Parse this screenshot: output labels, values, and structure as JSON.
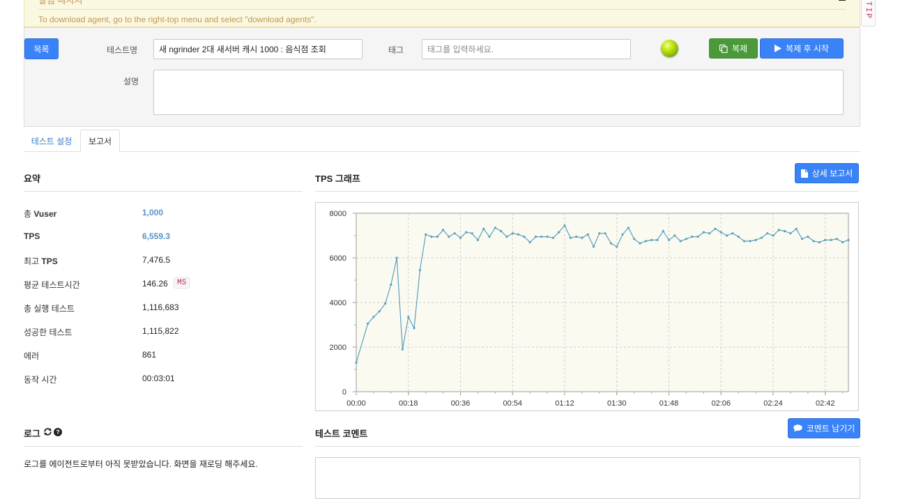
{
  "notice": {
    "title": "알림 메시지",
    "text": "To download agent, go to the right-top menu and select \"download agents\"."
  },
  "tip_tab": {
    "label": "TIP"
  },
  "form": {
    "list_button": "목록",
    "test_name_label": "테스트명",
    "test_name_value": "새 ngrinder 2대 새서버 캐시 1000 : 음식점 조회",
    "tag_label": "태그",
    "tag_placeholder": "태그를 입력하세요.",
    "description_label": "설명",
    "description_value": "",
    "copy_button": "복제",
    "copy_start_button": "복제 후 시작",
    "status_color": "#a6cc0e"
  },
  "tabs": [
    {
      "label": "테스트 설정",
      "active": false
    },
    {
      "label": "보고서",
      "active": true
    }
  ],
  "summary": {
    "title": "요약",
    "rows": [
      {
        "label_prefix": "총 ",
        "label_bold": "Vuser",
        "value": "1,000"
      },
      {
        "label_prefix": "",
        "label_bold": "TPS",
        "value": "6,559.3"
      },
      {
        "label_prefix": "최고 ",
        "label_bold": "TPS",
        "value": "7,476.5"
      },
      {
        "label_prefix": "평균 테스트시간",
        "label_bold": "",
        "value": "146.26",
        "unit": "MS"
      },
      {
        "label_prefix": "총 실행 테스트",
        "label_bold": "",
        "value": "1,116,683"
      },
      {
        "label_prefix": "성공한 테스트",
        "label_bold": "",
        "value": "1,115,822"
      },
      {
        "label_prefix": "에러",
        "label_bold": "",
        "value": "861"
      },
      {
        "label_prefix": "동작 시간",
        "label_bold": "",
        "value": "00:03:01"
      }
    ]
  },
  "tps_panel": {
    "title": "TPS 그래프",
    "detail_button": "상세 보고서"
  },
  "log": {
    "title": "로그",
    "message": "로그를 에이전트로부터 아직 못받았습니다. 화면을 재로딩 해주세요."
  },
  "comment": {
    "title": "테스트 코멘트",
    "button": "코멘트 남기기",
    "value": ""
  },
  "chart_data": {
    "type": "line",
    "title": "",
    "xlabel": "",
    "ylabel": "",
    "x_ticks": [
      "00:00",
      "00:18",
      "00:36",
      "00:54",
      "01:12",
      "01:30",
      "01:48",
      "02:06",
      "02:24",
      "02:42"
    ],
    "y_ticks": [
      0,
      2000,
      4000,
      6000,
      8000
    ],
    "xlim": [
      0,
      170
    ],
    "ylim": [
      0,
      8000
    ],
    "grid": true,
    "line_color": "#5a9fc0",
    "series": [
      {
        "name": "",
        "x": [
          0,
          4,
          6,
          8,
          10,
          12,
          14,
          16,
          18,
          20,
          22,
          24,
          26,
          28,
          30,
          32,
          34,
          36,
          38,
          40,
          42,
          44,
          46,
          48,
          50,
          52,
          54,
          56,
          58,
          60,
          62,
          64,
          66,
          68,
          70,
          72,
          74,
          76,
          78,
          80,
          82,
          84,
          86,
          88,
          90,
          92,
          94,
          96,
          98,
          100,
          102,
          104,
          106,
          108,
          110,
          112,
          114,
          116,
          118,
          120,
          122,
          124,
          126,
          128,
          130,
          132,
          134,
          136,
          138,
          140,
          142,
          144,
          146,
          148,
          150,
          152,
          154,
          156,
          158,
          160,
          162,
          164,
          166,
          168,
          170
        ],
        "values": [
          1300,
          3050,
          3350,
          3600,
          3950,
          4800,
          6000,
          1900,
          3350,
          2850,
          5450,
          7050,
          6950,
          6950,
          7250,
          6950,
          7100,
          6900,
          7150,
          7100,
          6800,
          7300,
          6950,
          7350,
          7200,
          6950,
          7100,
          7050,
          6950,
          6700,
          6950,
          6950,
          6950,
          6900,
          7150,
          7450,
          6900,
          6950,
          6900,
          7050,
          6500,
          7100,
          7100,
          6650,
          6500,
          7050,
          7350,
          6850,
          6650,
          6750,
          6800,
          6800,
          7200,
          6800,
          7000,
          6750,
          6850,
          6950,
          6950,
          7150,
          7100,
          7300,
          7150,
          7000,
          7100,
          6950,
          6750,
          6750,
          6800,
          6900,
          7100,
          7000,
          7250,
          7200,
          7100,
          7300,
          6850,
          6950,
          6750,
          6700,
          6800,
          6800,
          6850,
          6700,
          6800
        ]
      }
    ]
  }
}
